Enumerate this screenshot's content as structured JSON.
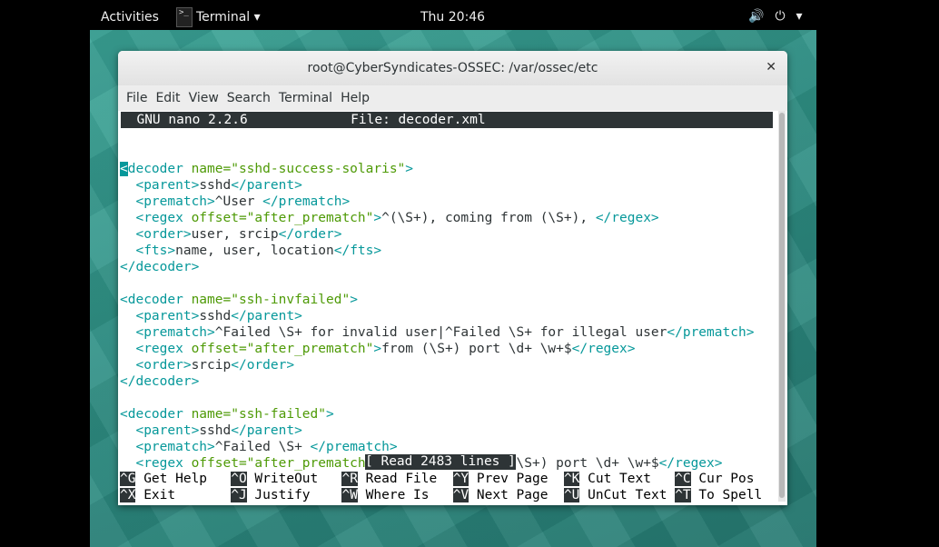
{
  "topbar": {
    "activities": "Activities",
    "app_name": "Terminal ▾",
    "app_icon_text": ">_",
    "clock": "Thu 20:46",
    "volume_icon": "🔊",
    "power_icon": "⏻",
    "menu_arrow": "▾"
  },
  "window": {
    "title": "root@CyberSyndicates-OSSEC: /var/ossec/etc",
    "close_glyph": "✕"
  },
  "menu": [
    "File",
    "Edit",
    "View",
    "Search",
    "Terminal",
    "Help"
  ],
  "nano": {
    "header": "  GNU nano 2.2.6             File: decoder.xml",
    "status": "[ Read 2483 lines ]"
  },
  "code_lines": [
    [],
    [
      [
        "tg",
        "<"
      ],
      [
        "tg",
        "decoder "
      ],
      [
        "av",
        "name=\"sshd-success-solaris\""
      ],
      [
        "tg",
        ">"
      ]
    ],
    [
      [
        "tx",
        "  "
      ],
      [
        "tg",
        "<parent>"
      ],
      [
        "tx",
        "sshd"
      ],
      [
        "tg",
        "</parent>"
      ]
    ],
    [
      [
        "tx",
        "  "
      ],
      [
        "tg",
        "<prematch>"
      ],
      [
        "tx",
        "^User "
      ],
      [
        "tg",
        "</prematch>"
      ]
    ],
    [
      [
        "tx",
        "  "
      ],
      [
        "tg",
        "<regex "
      ],
      [
        "av",
        "offset=\"after_prematch\""
      ],
      [
        "tg",
        ">"
      ],
      [
        "tx",
        "^(\\S+), coming from (\\S+), "
      ],
      [
        "tg",
        "</regex>"
      ]
    ],
    [
      [
        "tx",
        "  "
      ],
      [
        "tg",
        "<order>"
      ],
      [
        "tx",
        "user, srcip"
      ],
      [
        "tg",
        "</order>"
      ]
    ],
    [
      [
        "tx",
        "  "
      ],
      [
        "tg",
        "<fts>"
      ],
      [
        "tx",
        "name, user, location"
      ],
      [
        "tg",
        "</fts>"
      ]
    ],
    [
      [
        "tg",
        "</decoder>"
      ]
    ],
    [],
    [
      [
        "tg",
        "<decoder "
      ],
      [
        "av",
        "name=\"ssh-invfailed\""
      ],
      [
        "tg",
        ">"
      ]
    ],
    [
      [
        "tx",
        "  "
      ],
      [
        "tg",
        "<parent>"
      ],
      [
        "tx",
        "sshd"
      ],
      [
        "tg",
        "</parent>"
      ]
    ],
    [
      [
        "tx",
        "  "
      ],
      [
        "tg",
        "<prematch>"
      ],
      [
        "tx",
        "^Failed \\S+ for invalid user|^Failed \\S+ for illegal user"
      ],
      [
        "tg",
        "</prematch>"
      ]
    ],
    [
      [
        "tx",
        "  "
      ],
      [
        "tg",
        "<regex "
      ],
      [
        "av",
        "offset=\"after_prematch\""
      ],
      [
        "tg",
        ">"
      ],
      [
        "tx",
        "from (\\S+) port \\d+ \\w+$"
      ],
      [
        "tg",
        "</regex>"
      ]
    ],
    [
      [
        "tx",
        "  "
      ],
      [
        "tg",
        "<order>"
      ],
      [
        "tx",
        "srcip"
      ],
      [
        "tg",
        "</order>"
      ]
    ],
    [
      [
        "tg",
        "</decoder>"
      ]
    ],
    [],
    [
      [
        "tg",
        "<decoder "
      ],
      [
        "av",
        "name=\"ssh-failed\""
      ],
      [
        "tg",
        ">"
      ]
    ],
    [
      [
        "tx",
        "  "
      ],
      [
        "tg",
        "<parent>"
      ],
      [
        "tx",
        "sshd"
      ],
      [
        "tg",
        "</parent>"
      ]
    ],
    [
      [
        "tx",
        "  "
      ],
      [
        "tg",
        "<prematch>"
      ],
      [
        "tx",
        "^Failed \\S+ "
      ],
      [
        "tg",
        "</prematch>"
      ]
    ],
    [
      [
        "tx",
        "  "
      ],
      [
        "tg",
        "<regex "
      ],
      [
        "av",
        "offset=\"after_prematch\""
      ],
      [
        "tg",
        ">"
      ],
      [
        "tx",
        "^for (\\S+) from (\\S+) port \\d+ \\w+$"
      ],
      [
        "tg",
        "</regex>"
      ]
    ]
  ],
  "shortcuts": [
    [
      {
        "key": "^G",
        "label": " Get Help  "
      },
      {
        "key": "^O",
        "label": " WriteOut  "
      },
      {
        "key": "^R",
        "label": " Read File "
      },
      {
        "key": "^Y",
        "label": " Prev Page "
      },
      {
        "key": "^K",
        "label": " Cut Text  "
      },
      {
        "key": "^C",
        "label": " Cur Pos"
      }
    ],
    [
      {
        "key": "^X",
        "label": " Exit      "
      },
      {
        "key": "^J",
        "label": " Justify   "
      },
      {
        "key": "^W",
        "label": " Where Is  "
      },
      {
        "key": "^V",
        "label": " Next Page "
      },
      {
        "key": "^U",
        "label": " UnCut Text"
      },
      {
        "key": "^T",
        "label": " To Spell"
      }
    ]
  ]
}
